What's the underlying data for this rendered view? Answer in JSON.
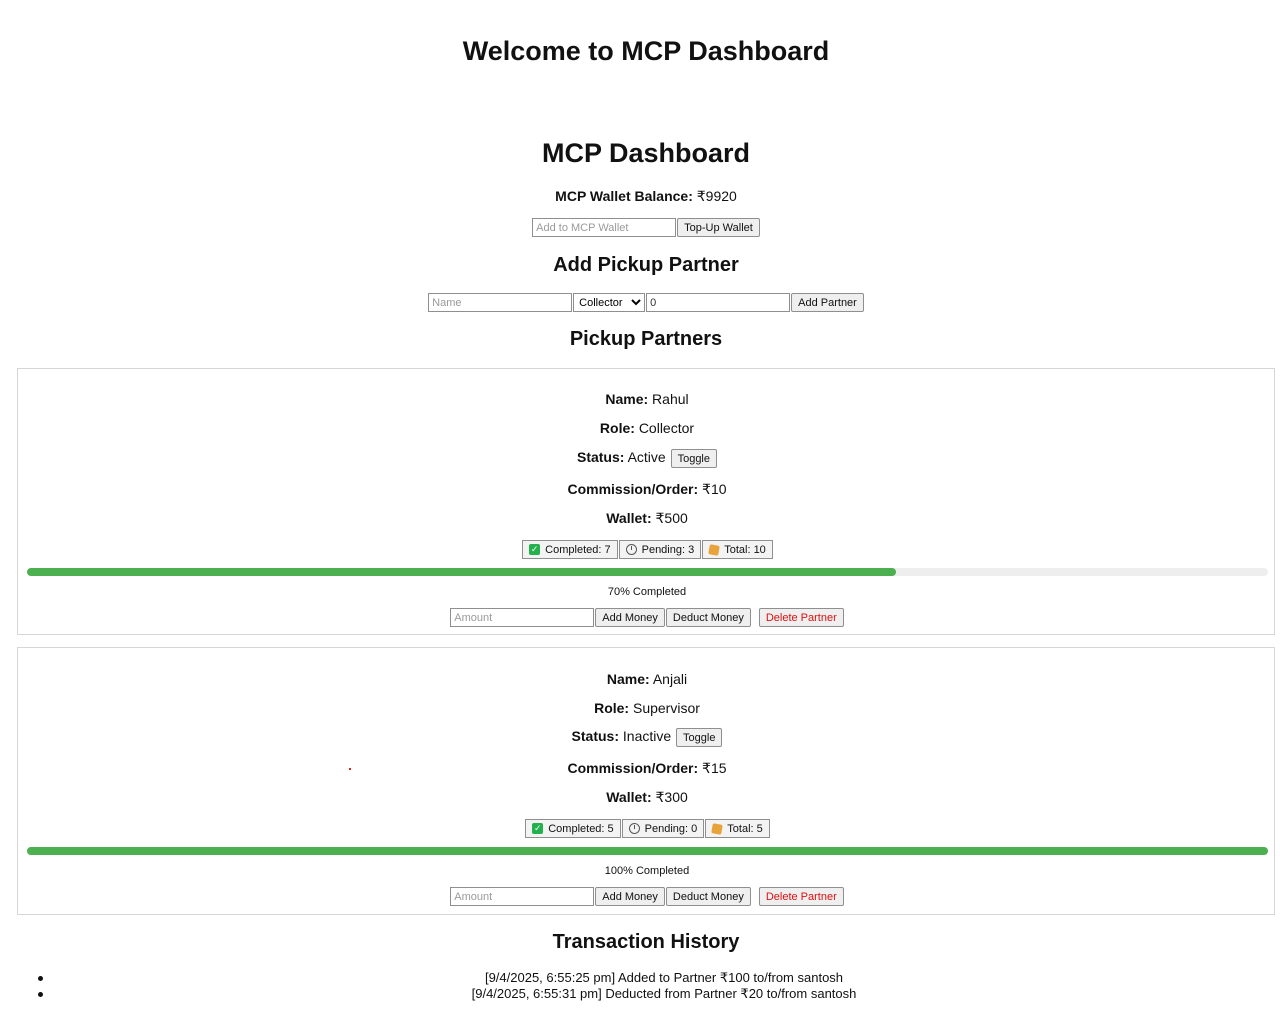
{
  "page": {
    "welcome": "Welcome to MCP Dashboard",
    "title": "MCP Dashboard"
  },
  "wallet": {
    "label": "MCP Wallet Balance:",
    "value": "₹9920",
    "input_placeholder": "Add to MCP Wallet",
    "topup_label": "Top-Up Wallet"
  },
  "add_partner": {
    "heading": "Add Pickup Partner",
    "name_placeholder": "Name",
    "role_selected": "Collector",
    "commission_value": "0",
    "button_label": "Add Partner"
  },
  "partners_heading": "Pickup Partners",
  "labels": {
    "name": "Name:",
    "role": "Role:",
    "status": "Status:",
    "commission": "Commission/Order:",
    "wallet": "Wallet:",
    "toggle": "Toggle",
    "amount_placeholder": "Amount",
    "add_money": "Add Money",
    "deduct_money": "Deduct Money",
    "delete": "Delete Partner"
  },
  "partners": [
    {
      "name": "Rahul",
      "role": "Collector",
      "status": "Active",
      "commission": "₹10",
      "wallet": "₹500",
      "completed": "Completed: 7",
      "pending": "Pending: 3",
      "total": "Total: 10",
      "progress": 0.7,
      "progress_text": "70% Completed"
    },
    {
      "name": "Anjali",
      "role": "Supervisor",
      "status": "Inactive",
      "commission": "₹15",
      "wallet": "₹300",
      "completed": "Completed: 5",
      "pending": "Pending: 0",
      "total": "Total: 5",
      "progress": 1.0,
      "progress_text": "100% Completed"
    }
  ],
  "transactions": {
    "heading": "Transaction History",
    "items": [
      "[9/4/2025, 6:55:25 pm] Added to Partner ₹100 to/from santosh",
      "[9/4/2025, 6:55:31 pm] Deducted from Partner ₹20 to/from santosh"
    ]
  },
  "colors": {
    "progress_fill": "#4caf50",
    "progress_track": "#eeeeee",
    "danger": "#dd1111"
  }
}
